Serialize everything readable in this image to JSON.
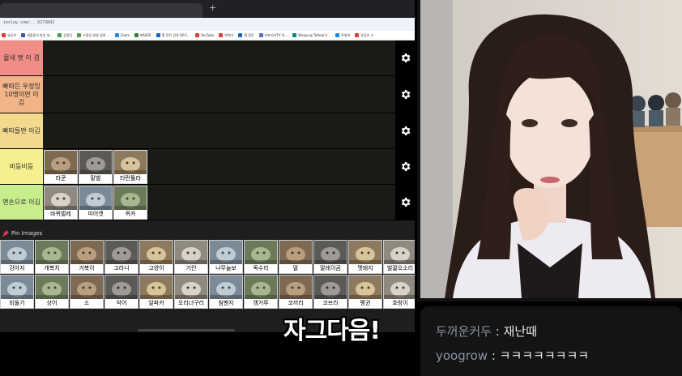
{
  "browser": {
    "url": "ieslay.com/...0273842",
    "bookmarks": [
      {
        "label": "유튜브",
        "color": "#e53935"
      },
      {
        "label": "새컴퓨터 방송 세...",
        "color": "#3f51b5"
      },
      {
        "label": "검정진",
        "color": "#43a047"
      },
      {
        "label": "우정잉 방송 일정 ...",
        "color": "#43a047"
      },
      {
        "label": "Zoom",
        "color": "#1e88e5"
      },
      {
        "label": "NAVER",
        "color": "#2e7d32"
      },
      {
        "label": "랭 전적 검색 OP.G...",
        "color": "#1565c0"
      },
      {
        "label": "YouTube",
        "color": "#e53935"
      },
      {
        "label": "번역기",
        "color": "#e53935"
      },
      {
        "label": "랭 질문",
        "color": "#1565c0"
      },
      {
        "label": "아프리카TV 리...",
        "color": "#5c6bc0"
      },
      {
        "label": "Woojung Tattoo(우...",
        "color": "#00897b"
      },
      {
        "label": "트위터",
        "color": "#1e88e5"
      },
      {
        "label": "유튜브 스",
        "color": "#e53935"
      }
    ]
  },
  "tiers": [
    {
      "label": "물새 랫 이 겸",
      "color": "#ef8d86",
      "items": []
    },
    {
      "label": "빠따든 우정잉 10명이면 이김",
      "color": "#f0b488",
      "items": []
    },
    {
      "label": "빠따들면 이김",
      "color": "#f3d98e",
      "items": []
    },
    {
      "label": "비등비등",
      "color": "#f4f08f",
      "items": [
        {
          "name": "라쿤",
          "icon": "raccoon-image"
        },
        {
          "name": "말벌",
          "icon": "hornet-image"
        },
        {
          "name": "타란튤라",
          "icon": "tarantula-image"
        }
      ]
    },
    {
      "label": "맨손으로 이김",
      "color": "#c8ee8c",
      "items": [
        {
          "name": "바퀴벌레",
          "icon": "cockroach-image"
        },
        {
          "name": "미어캣",
          "icon": "meerkat-image"
        },
        {
          "name": "퀴카",
          "icon": "quokka-image"
        }
      ]
    }
  ],
  "pin": {
    "title": "Pin Images",
    "rows": [
      [
        "강아지",
        "개복치",
        "거북이",
        "고라니",
        "고양이",
        "기린",
        "나무늘보",
        "독수리",
        "말",
        "말레이곰",
        "멧돼지",
        "벌꿀오소리"
      ],
      [
        "비둘기",
        "상어",
        "소",
        "악어",
        "알파카",
        "오리너구리",
        "침팬지",
        "캥거루",
        "코끼리",
        "코브라",
        "펭귄",
        "호랑이"
      ]
    ]
  },
  "subtitle": "자그다음!",
  "chat": [
    {
      "user": "두꺼운커두",
      "message": "재난때"
    },
    {
      "user": "yoogrow",
      "message": "ㅋㅋㅋㅋㅋㅋㅋㅋ"
    },
    {
      "user": "",
      "message": ""
    }
  ],
  "colors": {
    "accent_tier_bg": "#1a1a17",
    "chat_user": "#8b93a4",
    "chat_bg": "#141414"
  }
}
